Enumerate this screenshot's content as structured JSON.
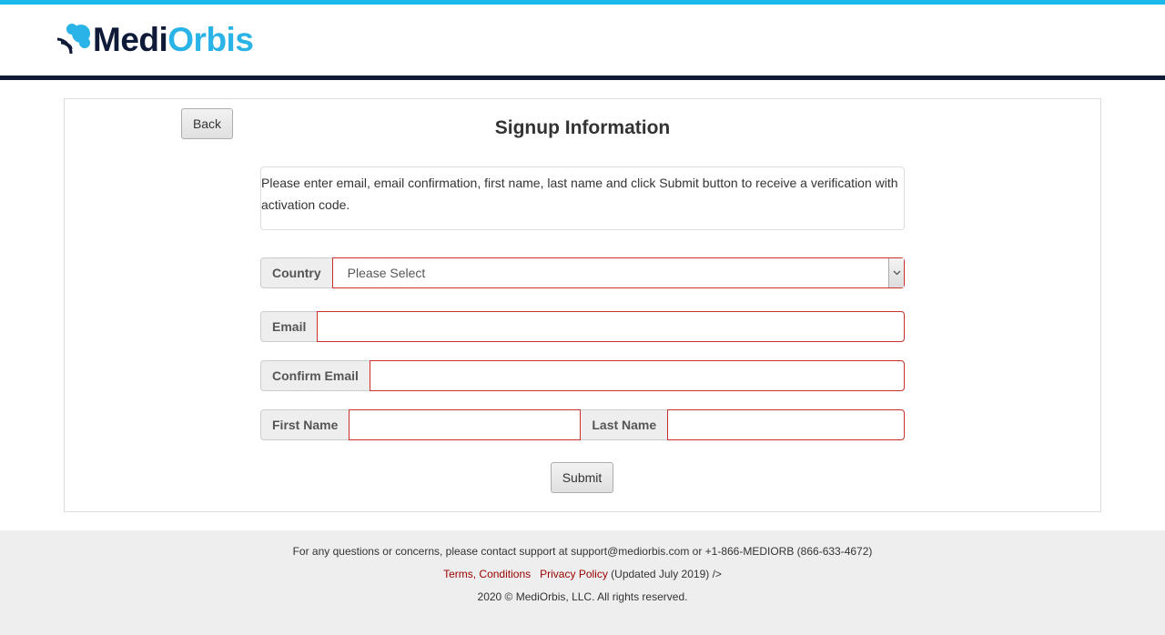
{
  "brand": {
    "logo_medi": "Medi",
    "logo_orbis": "Orbis",
    "colors": {
      "accent": "#1cb8ec",
      "navy": "#0e1a38",
      "logo_blue": "#29b3e6",
      "error_border": "#c9302c",
      "link": "#990000"
    }
  },
  "page": {
    "back_label": "Back",
    "title": "Signup Information",
    "instructions": "Please enter email, email confirmation, first name, last name and click Submit button to receive a verification with activation code."
  },
  "form": {
    "country_label": "Country",
    "country_selected": "Please Select",
    "email_label": "Email",
    "email_value": "",
    "confirm_email_label": "Confirm Email",
    "confirm_email_value": "",
    "first_name_label": "First Name",
    "first_name_value": "",
    "last_name_label": "Last Name",
    "last_name_value": "",
    "submit_label": "Submit"
  },
  "footer": {
    "contact_text": "For any questions or concerns, please contact support at support@mediorbis.com or +1-866-MEDIORB (866-633-4672)",
    "terms_link": "Terms, Conditions",
    "privacy_link": "Privacy Policy",
    "updated_text": "(Updated July 2019) />",
    "copyright": "2020 © MediOrbis, LLC. All rights reserved."
  },
  "icons": {
    "logo_mark": "orbis-signal-icon",
    "select_arrow": "chevron-down-icon"
  }
}
